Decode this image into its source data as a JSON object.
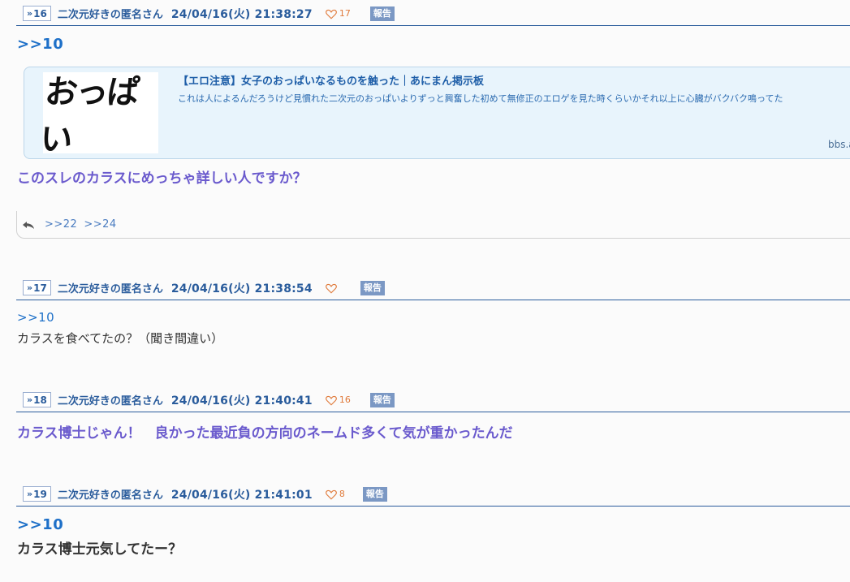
{
  "posts": [
    {
      "number": "16",
      "author": "二次元好きの匿名さん",
      "date": "24/04/16(火) 21:38:27",
      "likes": "17",
      "report": "報告",
      "anchor": ">>10",
      "link": {
        "thumb_text": "おっぱい",
        "title": "【エロ注意】女子のおっぱいなるものを触った｜あにまん掲示板",
        "description": "これは人によるんだろうけど見慣れた二次元のおっぱいよりずっと興奮した初めて無修正のエロゲを見た時くらいかそれ以上に心臓がバクバク鳴ってた",
        "domain": "bbs.a"
      },
      "body": "このスレのカラスにめっちゃ詳しい人ですか？",
      "replies": [
        ">>22",
        ">>24"
      ]
    },
    {
      "number": "17",
      "author": "二次元好きの匿名さん",
      "date": "24/04/16(火) 21:38:54",
      "likes": "",
      "report": "報告",
      "anchor": ">>10",
      "body": "カラスを食べてたの？（聞き間違い）"
    },
    {
      "number": "18",
      "author": "二次元好きの匿名さん",
      "date": "24/04/16(火) 21:40:41",
      "likes": "16",
      "report": "報告",
      "body": "カラス博士じゃん！　良かった最近負の方向のネームド多くて気が重かったんだ"
    },
    {
      "number": "19",
      "author": "二次元好きの匿名さん",
      "date": "24/04/16(火) 21:41:01",
      "likes": "8",
      "report": "報告",
      "anchor": ">>10",
      "body": "カラス博士元気してたー？"
    }
  ],
  "icons": {
    "res_no": "double-chevron-icon",
    "like": "heart-outline-icon",
    "reply": "reply-arrow-icon"
  },
  "colors": {
    "accent": "#2a5c9c",
    "anchor": "#1e70c8",
    "purple": "#6a5acd",
    "like": "#e07b3c",
    "report_bg": "#7b98c4",
    "link_card_bg": "#e8f4fc"
  }
}
